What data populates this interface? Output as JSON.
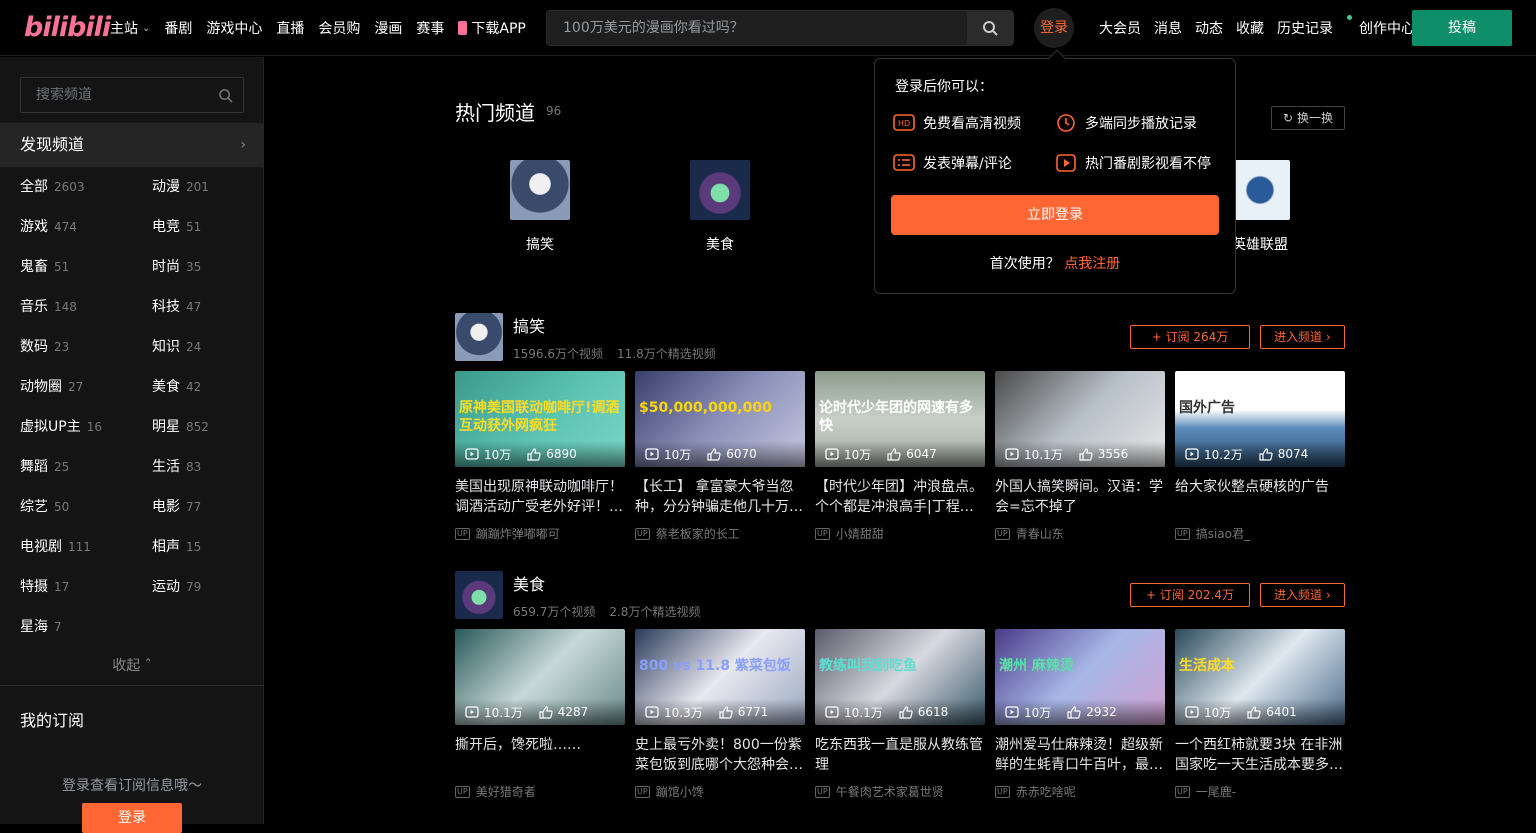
{
  "header": {
    "logo": "bilibili",
    "nav": [
      "主站",
      "番剧",
      "游戏中心",
      "直播",
      "会员购",
      "漫画",
      "赛事",
      "下载APP"
    ],
    "search_placeholder": "100万美元的漫画你看过吗？",
    "login": "登录",
    "right_nav": [
      "大会员",
      "消息",
      "动态",
      "收藏",
      "历史记录",
      "创作中心"
    ],
    "upload": "投稿"
  },
  "sidebar": {
    "search_placeholder": "搜索频道",
    "discover": "发现频道",
    "categories": [
      {
        "name": "全部",
        "count": "2603"
      },
      {
        "name": "动漫",
        "count": "201"
      },
      {
        "name": "游戏",
        "count": "474"
      },
      {
        "name": "电竞",
        "count": "51"
      },
      {
        "name": "鬼畜",
        "count": "51"
      },
      {
        "name": "时尚",
        "count": "35"
      },
      {
        "name": "音乐",
        "count": "148"
      },
      {
        "name": "科技",
        "count": "47"
      },
      {
        "name": "数码",
        "count": "23"
      },
      {
        "name": "知识",
        "count": "24"
      },
      {
        "name": "动物圈",
        "count": "27"
      },
      {
        "name": "美食",
        "count": "42"
      },
      {
        "name": "虚拟UP主",
        "count": "16"
      },
      {
        "name": "明星",
        "count": "852"
      },
      {
        "name": "舞蹈",
        "count": "25"
      },
      {
        "name": "生活",
        "count": "83"
      },
      {
        "name": "综艺",
        "count": "50"
      },
      {
        "name": "电影",
        "count": "77"
      },
      {
        "name": "电视剧",
        "count": "111"
      },
      {
        "name": "相声",
        "count": "15"
      },
      {
        "name": "特摄",
        "count": "17"
      },
      {
        "name": "运动",
        "count": "79"
      },
      {
        "name": "星海",
        "count": "7"
      }
    ],
    "collapse": "收起",
    "my_sub": "我的订阅",
    "sub_hint": "登录查看订阅信息哦～",
    "login_btn": "登录"
  },
  "hot": {
    "title": "热门频道",
    "count": "96",
    "swap": "换一换",
    "items": [
      "搞笑",
      "美食",
      "英雄联盟"
    ]
  },
  "sections": [
    {
      "title": "搞笑",
      "videos_count": "1596.6万个视频",
      "featured_count": "11.8万个精选视频",
      "subscribe": "订阅 264万",
      "enter": "进入频道",
      "cards": [
        {
          "views": "10万",
          "likes": "6890",
          "title": "美国出现原神联动咖啡厅！调酒活动广受老外好评！…",
          "up": "蹦蹦炸弹嘟嘟可",
          "thumb_text": "原神美国联动咖啡厅!调酒互动获外网疯狂"
        },
        {
          "views": "10万",
          "likes": "6070",
          "title": "【长工】 拿富豪大爷当忽种，分分钟骗走他几十万…",
          "up": "蔡老板家的长工",
          "thumb_text": "$50,000,000,000"
        },
        {
          "views": "10万",
          "likes": "6047",
          "title": "【时代少年团】冲浪盘点。个个都是冲浪高手|丁程…",
          "up": "小婧甜甜",
          "thumb_text": "论时代少年团的网速有多快"
        },
        {
          "views": "10.1万",
          "likes": "3556",
          "title": "外国人搞笑瞬间。汉语：学会=忘不掉了",
          "up": "青春山东",
          "thumb_text": ""
        },
        {
          "views": "10.2万",
          "likes": "8074",
          "title": "给大家伙整点硬核的广告",
          "up": "搞siao君_",
          "thumb_text": "国外广告"
        }
      ]
    },
    {
      "title": "美食",
      "videos_count": "659.7万个视频",
      "featured_count": "2.8万个精选视频",
      "subscribe": "订阅 202.4万",
      "enter": "进入频道",
      "cards": [
        {
          "views": "10.1万",
          "likes": "4287",
          "title": "撕开后，馋死啦……",
          "up": "美好猎奇者",
          "thumb_text": ""
        },
        {
          "views": "10.3万",
          "likes": "6771",
          "title": "史上最亏外卖！800一份紫菜包饭到底哪个大怨种会…",
          "up": "蹦馆小馋",
          "thumb_text": "800 vs 11.8 紫菜包饭"
        },
        {
          "views": "10.1万",
          "likes": "6618",
          "title": "吃东西我一直是服从教练管理",
          "up": "午餐肉艺术家葛世贤",
          "thumb_text": "教练叫我别吃鱼"
        },
        {
          "views": "10万",
          "likes": "2932",
          "title": "潮州爱马仕麻辣烫！超级新鲜的生蚝青口牛百叶，最…",
          "up": "赤赤吃啥呢",
          "thumb_text": "潮州 麻辣烫"
        },
        {
          "views": "10万",
          "likes": "6401",
          "title": "一个西红柿就要3块 在非洲国家吃一天生活成本要多…",
          "up": "一尾鹿-",
          "thumb_text": "生活成本"
        }
      ]
    }
  ],
  "popup": {
    "title": "登录后你可以：",
    "items": [
      "免费看高清视频",
      "多端同步播放记录",
      "发表弹幕/评论",
      "热门番剧影视看不停"
    ],
    "button": "立即登录",
    "footer": "首次使用？",
    "register": "点我注册"
  },
  "colors": {
    "accent": "#ff6633",
    "upload": "#0f8e6a",
    "logo": "#fb7299"
  }
}
